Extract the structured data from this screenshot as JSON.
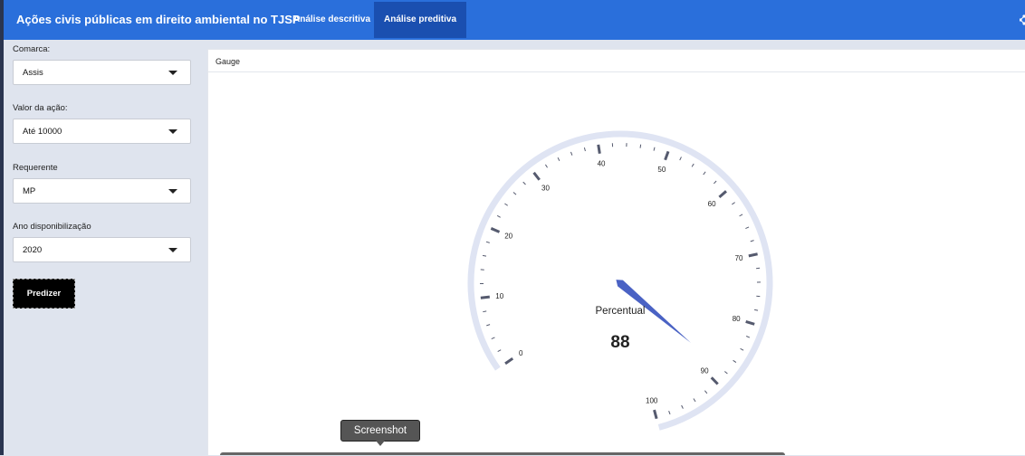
{
  "app": {
    "title": "Ações civis públicas em direito ambiental no TJSP",
    "tabs": [
      {
        "label": "Análise descritiva",
        "active": false
      },
      {
        "label": "Análise preditiva",
        "active": true
      }
    ],
    "share_icon": "share-icon"
  },
  "sidebar": {
    "fields": [
      {
        "label": "Comarca:",
        "value": "Assis"
      },
      {
        "label": "Valor da ação:",
        "value": "Até 10000"
      },
      {
        "label": "Requerente",
        "value": "MP"
      },
      {
        "label": "Ano disponibilização",
        "value": "2020"
      }
    ],
    "predict_button": "Predizer"
  },
  "panel": {
    "title": "Gauge"
  },
  "gauge": {
    "label": "Percentual",
    "value": 88,
    "min": 0,
    "max": 100,
    "tick_labels": [
      "0",
      "10",
      "20",
      "30",
      "40",
      "50",
      "60",
      "70",
      "80",
      "90",
      "100"
    ],
    "band_color": "#dfe4f3",
    "needle_color": "#4a62c4",
    "tick_color": "#555a6e"
  },
  "overlay": {
    "tooltip": "Screenshot"
  }
}
